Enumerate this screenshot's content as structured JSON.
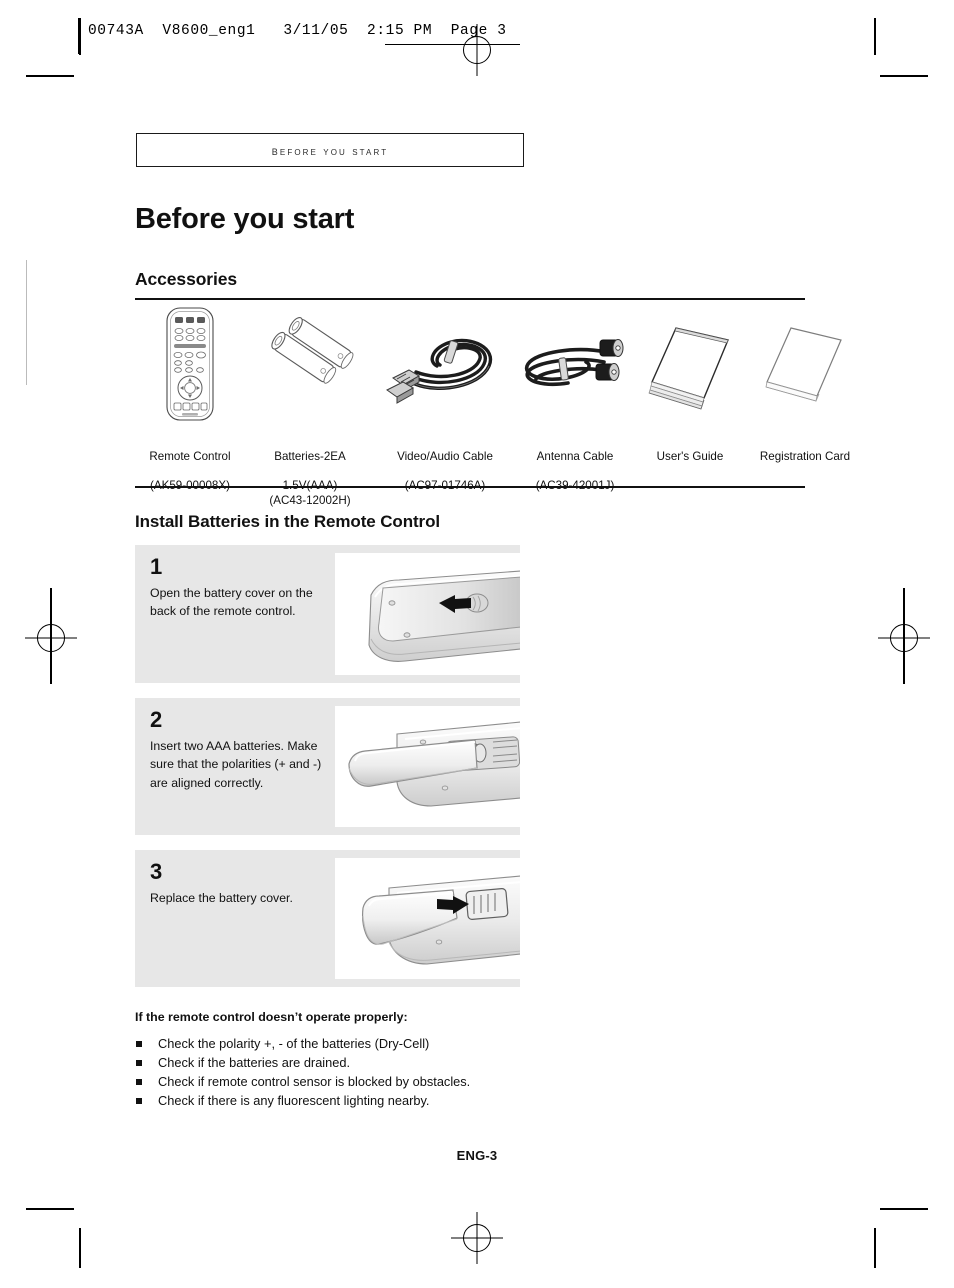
{
  "slug": {
    "text": "00743A  V8600_eng1   3/11/05  2:15 PM  Page 3"
  },
  "running_head": {
    "label": "Before you start"
  },
  "title": "Before you start",
  "sections": {
    "accessories": {
      "heading": "Accessories"
    },
    "install": {
      "heading": "Install Batteries in the Remote Control"
    }
  },
  "accessories": [
    {
      "icon": "remote-control-icon",
      "name": "Remote Control",
      "part": "(AK59-00008X)"
    },
    {
      "icon": "batteries-icon",
      "name": "Batteries-2EA",
      "part": "1.5V(AAA)\n(AC43-12002H)"
    },
    {
      "icon": "av-cable-icon",
      "name": "Video/Audio Cable",
      "part": "(AC97-01746A)"
    },
    {
      "icon": "antenna-cable-icon",
      "name": "Antenna Cable",
      "part": "(AC39-42001J)"
    },
    {
      "icon": "users-guide-icon",
      "name": "User's Guide",
      "part": ""
    },
    {
      "icon": "registration-card-icon",
      "name": "Registration Card",
      "part": ""
    }
  ],
  "steps": [
    {
      "number": "1",
      "text": "Open the battery cover on the back of the remote control.",
      "arrow": "left"
    },
    {
      "number": "2",
      "text": "Insert two AAA batteries. Make sure that the polarities (+ and -) are aligned correctly.",
      "arrow": "none"
    },
    {
      "number": "3",
      "text": "Replace the battery cover.",
      "arrow": "right"
    }
  ],
  "troubleshooting": {
    "lead": "If the remote control doesn’t operate properly:",
    "items": [
      "Check the polarity +, - of the batteries (Dry-Cell)",
      "Check if the batteries are drained.",
      "Check if remote control sensor is blocked by obstacles.",
      "Check if there is any fluorescent lighting nearby."
    ]
  },
  "footer": {
    "page_label": "ENG-3"
  },
  "colors": {
    "panel": "#e7e7e7",
    "ink": "#111111",
    "rule": "#111111"
  }
}
